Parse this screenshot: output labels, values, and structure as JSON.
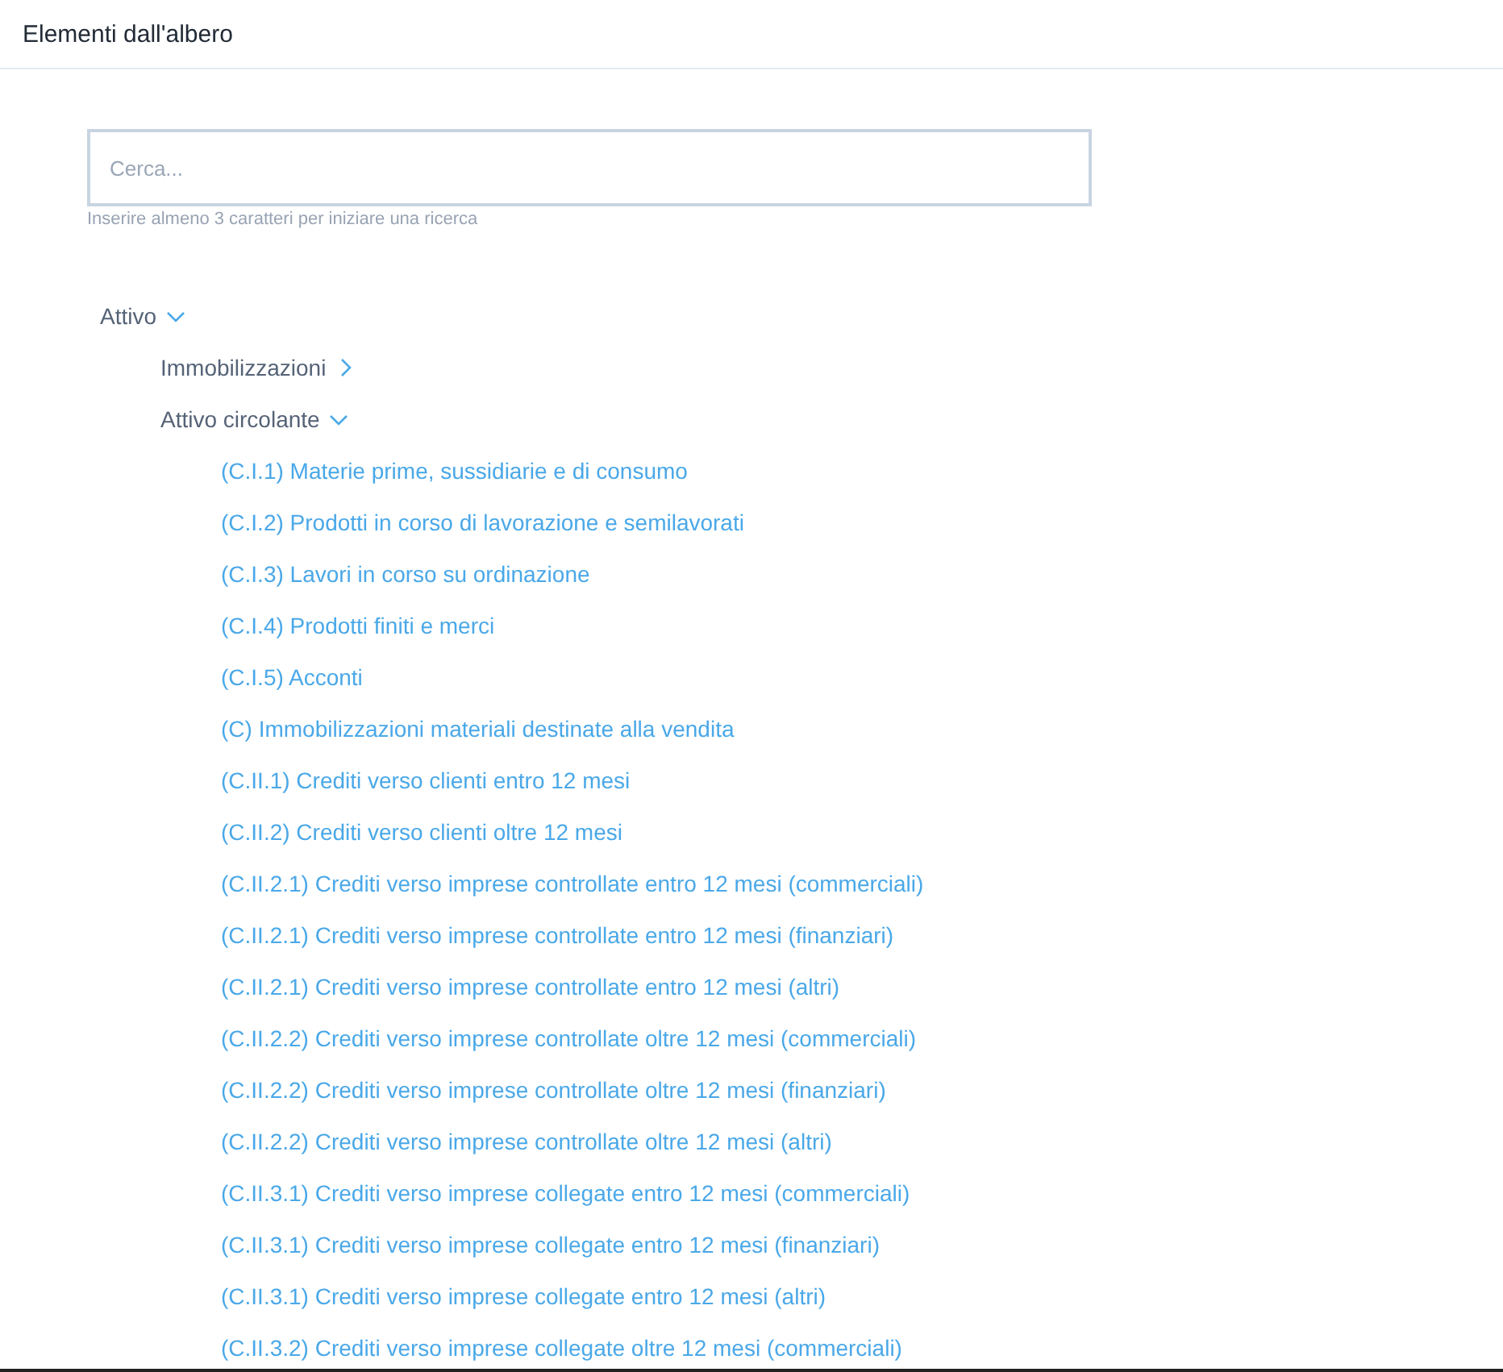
{
  "header": {
    "title": "Elementi dall'albero"
  },
  "search": {
    "placeholder": "Cerca...",
    "hint": "Inserire almeno 3 caratteri per iniziare una ricerca"
  },
  "tree": [
    {
      "kind": "group",
      "label": "Attivo",
      "expanded": true,
      "children": [
        {
          "kind": "group",
          "label": "Immobilizzazioni",
          "expanded": false
        },
        {
          "kind": "group",
          "label": "Attivo circolante",
          "expanded": true,
          "children": [
            {
              "kind": "leaf",
              "label": "(C.I.1) Materie prime, sussidiarie e di consumo"
            },
            {
              "kind": "leaf",
              "label": "(C.I.2) Prodotti in corso di lavorazione e semilavorati"
            },
            {
              "kind": "leaf",
              "label": "(C.I.3) Lavori in corso su ordinazione"
            },
            {
              "kind": "leaf",
              "label": "(C.I.4) Prodotti finiti e merci"
            },
            {
              "kind": "leaf",
              "label": "(C.I.5) Acconti"
            },
            {
              "kind": "leaf",
              "label": "(C) Immobilizzazioni materiali destinate alla vendita"
            },
            {
              "kind": "leaf",
              "label": "(C.II.1) Crediti verso clienti entro 12 mesi"
            },
            {
              "kind": "leaf",
              "label": "(C.II.2) Crediti verso clienti oltre 12 mesi"
            },
            {
              "kind": "leaf",
              "label": "(C.II.2.1) Crediti verso imprese controllate entro 12 mesi (commerciali)"
            },
            {
              "kind": "leaf",
              "label": "(C.II.2.1) Crediti verso imprese controllate entro 12 mesi (finanziari)"
            },
            {
              "kind": "leaf",
              "label": "(C.II.2.1) Crediti verso imprese controllate entro 12 mesi (altri)"
            },
            {
              "kind": "leaf",
              "label": "(C.II.2.2) Crediti verso imprese controllate oltre 12 mesi (commerciali)"
            },
            {
              "kind": "leaf",
              "label": "(C.II.2.2) Crediti verso imprese controllate oltre 12 mesi (finanziari)"
            },
            {
              "kind": "leaf",
              "label": "(C.II.2.2) Crediti verso imprese controllate oltre 12 mesi (altri)"
            },
            {
              "kind": "leaf",
              "label": "(C.II.3.1) Crediti verso imprese collegate entro 12 mesi (commerciali)"
            },
            {
              "kind": "leaf",
              "label": "(C.II.3.1) Crediti verso imprese collegate entro 12 mesi (finanziari)"
            },
            {
              "kind": "leaf",
              "label": "(C.II.3.1) Crediti verso imprese collegate entro 12 mesi (altri)"
            },
            {
              "kind": "leaf",
              "label": "(C.II.3.2) Crediti verso imprese collegate oltre 12 mesi (commerciali)"
            }
          ]
        }
      ]
    }
  ]
}
